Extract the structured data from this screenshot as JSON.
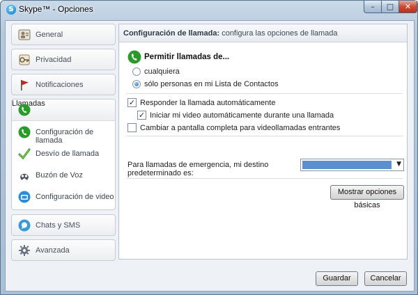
{
  "window": {
    "title": "Skype™ - Opciones",
    "controls": {
      "minimize": "–",
      "maximize": "□",
      "close": "✕"
    }
  },
  "sidebar": {
    "items": [
      {
        "label": "General",
        "icon": "general-icon"
      },
      {
        "label": "Privacidad",
        "icon": "privacy-icon"
      },
      {
        "label": "Notificaciones",
        "icon": "flag-icon"
      },
      {
        "label": "Llamadas",
        "icon": "phone-icon"
      }
    ],
    "subitems": [
      {
        "label": "Configuración de llamada",
        "icon": "phone-icon"
      },
      {
        "label": "Desvío de llamada",
        "icon": "forward-check-icon"
      },
      {
        "label": "Buzón de Voz",
        "icon": "voicemail-icon"
      },
      {
        "label": "Configuración de video",
        "icon": "video-icon"
      }
    ],
    "bottom": [
      {
        "label": "Chats y SMS",
        "icon": "chat-icon"
      },
      {
        "label": "Avanzada",
        "icon": "gear-icon"
      }
    ]
  },
  "panel": {
    "header_bold": "Configuración de llamada:",
    "header_rest": " configura las opciones de llamada",
    "allow_title": "Permitir llamadas de...",
    "radio_any": "cualquiera",
    "radio_contacts": "sólo personas en mi Lista de Contactos",
    "auto_answer": "Responder la llamada automáticamente",
    "auto_video": "Iniciar mi video automáticamente durante una llamada",
    "fullscreen": "Cambiar a pantalla completa para videollamadas entrantes",
    "emergency_label": "Para llamadas de emergencia, mi destino predeterminado es:",
    "basic_options_button": "Mostrar opciones básicas",
    "state": {
      "radio_selected": "contacts",
      "auto_answer": true,
      "auto_video": true,
      "fullscreen": false
    }
  },
  "footer": {
    "save": "Guardar",
    "cancel": "Cancelar"
  },
  "colors": {
    "skype_blue": "#0b78c5",
    "call_green": "#2a9a2a",
    "selection_blue": "#5b8fd0"
  }
}
